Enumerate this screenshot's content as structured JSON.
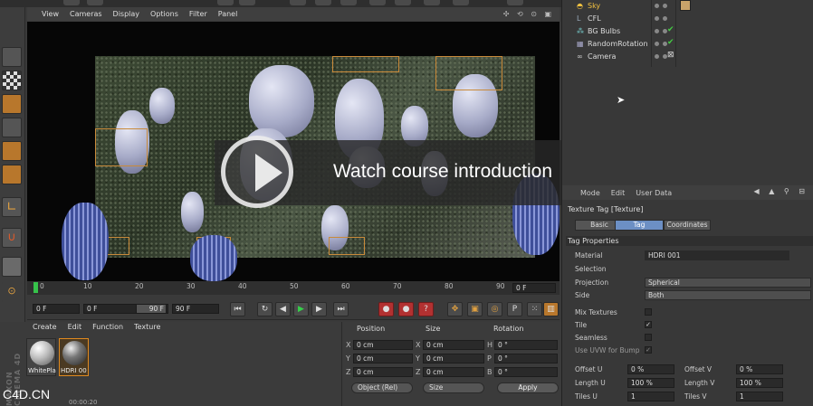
{
  "viewport_menu": [
    "View",
    "Cameras",
    "Display",
    "Options",
    "Filter",
    "Panel"
  ],
  "viewport_icons": "✣ ⟲ ⊙ ▣",
  "overlay": {
    "text": "Watch course introduction"
  },
  "timeline": {
    "ticks": [
      "0",
      "10",
      "20",
      "30",
      "40",
      "50",
      "60",
      "70",
      "80",
      "90"
    ],
    "frame_field": "0 F"
  },
  "transport": {
    "start_field": "0 F",
    "current_field": "0 F",
    "range_end_field": "90 F",
    "end_field": "90 F"
  },
  "material_manager": {
    "menu": [
      "Create",
      "Edit",
      "Function",
      "Texture"
    ],
    "materials": [
      {
        "name": "WhitePlas",
        "selected": false
      },
      {
        "name": "HDRI 00",
        "selected": true
      }
    ]
  },
  "branding": {
    "maxon": "MAXON CINEMA 4D",
    "watermark": "C4D.CN",
    "timecode": "00:00:20"
  },
  "coordinates": {
    "headers": {
      "position": "Position",
      "size": "Size",
      "rotation": "Rotation"
    },
    "rows": [
      {
        "axis": "X",
        "pos": "0 cm",
        "size_axis": "X",
        "size": "0 cm",
        "rot_axis": "H",
        "rot": "0 °"
      },
      {
        "axis": "Y",
        "pos": "0 cm",
        "size_axis": "Y",
        "size": "0 cm",
        "rot_axis": "P",
        "rot": "0 °"
      },
      {
        "axis": "Z",
        "pos": "0 cm",
        "size_axis": "Z",
        "size": "0 cm",
        "rot_axis": "B",
        "rot": "0 °"
      }
    ],
    "mode_dropdown": "Object (Rel)",
    "size_dropdown": "Size",
    "apply_label": "Apply"
  },
  "object_manager": {
    "objects": [
      {
        "name": "Sky",
        "icon": "sky-icon"
      },
      {
        "name": "CFL",
        "icon": "null-object-icon"
      },
      {
        "name": "BG Bulbs",
        "icon": "cloner-icon"
      },
      {
        "name": "RandomRotation",
        "icon": "effector-icon"
      },
      {
        "name": "Camera",
        "icon": "camera-icon"
      }
    ]
  },
  "attributes": {
    "menu": [
      "Mode",
      "Edit",
      "User Data"
    ],
    "title": "Texture Tag [Texture]",
    "tabs": [
      {
        "label": "Basic",
        "active": false
      },
      {
        "label": "Tag",
        "active": true
      },
      {
        "label": "Coordinates",
        "active": false
      }
    ],
    "section": "Tag Properties",
    "material_label": "Material",
    "material_value": "HDRI 001",
    "selection_label": "Selection",
    "projection_label": "Projection",
    "projection_value": "Spherical",
    "side_label": "Side",
    "side_value": "Both",
    "mix_textures_label": "Mix Textures",
    "tile_label": "Tile",
    "seamless_label": "Seamless",
    "use_uvw_label": "Use UVW for Bump",
    "offset_u_label": "Offset U",
    "offset_u_value": "0 %",
    "offset_v_label": "Offset V",
    "offset_v_value": "0 %",
    "length_u_label": "Length U",
    "length_u_value": "100 %",
    "length_v_label": "Length V",
    "length_v_value": "100 %",
    "tiles_u_label": "Tiles U",
    "tiles_u_value": "1",
    "tiles_v_label": "Tiles V",
    "tiles_v_value": "1"
  },
  "colors": {
    "accent": "#6c8fc4",
    "selection": "#e08a1f",
    "play": "#36d04a",
    "record": "#b23131"
  }
}
